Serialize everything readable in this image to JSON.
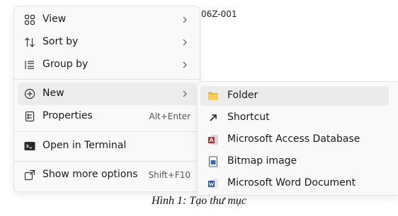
{
  "background_text": "06Z-001",
  "context_menu": {
    "items": [
      {
        "label": "View",
        "icon": "view-icon",
        "has_submenu": true
      },
      {
        "label": "Sort by",
        "icon": "sort-icon",
        "has_submenu": true
      },
      {
        "label": "Group by",
        "icon": "group-icon",
        "has_submenu": true
      },
      {
        "label": "New",
        "icon": "new-plus-icon",
        "has_submenu": true,
        "highlighted": true
      },
      {
        "label": "Properties",
        "icon": "properties-icon",
        "shortcut": "Alt+Enter"
      },
      {
        "label": "Open in Terminal",
        "icon": "terminal-icon"
      },
      {
        "label": "Show more options",
        "icon": "more-options-icon",
        "shortcut": "Shift+F10"
      }
    ]
  },
  "new_submenu": {
    "items": [
      {
        "label": "Folder",
        "icon": "folder-icon",
        "highlighted": true
      },
      {
        "label": "Shortcut",
        "icon": "shortcut-icon"
      },
      {
        "label": "Microsoft Access Database",
        "icon": "access-icon"
      },
      {
        "label": "Bitmap image",
        "icon": "bitmap-icon"
      },
      {
        "label": "Microsoft Word Document",
        "icon": "word-icon"
      }
    ]
  },
  "caption": "Hình 1: Tạo thư mục",
  "colors": {
    "menu_bg": "#f9f9f9",
    "highlight": "#ececec",
    "folder": "#f2c84b",
    "access": "#a4373a",
    "word": "#2b579a"
  }
}
